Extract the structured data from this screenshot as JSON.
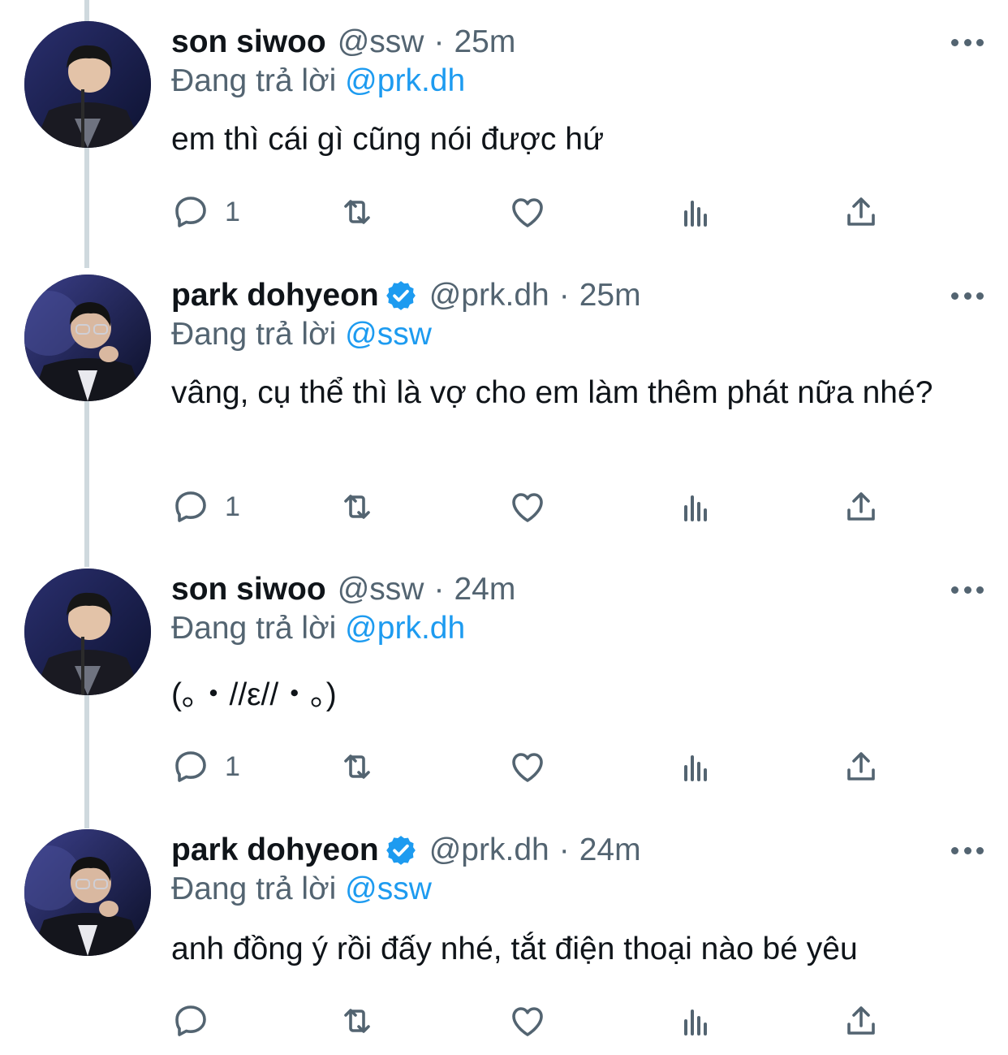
{
  "colors": {
    "accent": "#1d9bf0",
    "secondary_text": "#536471",
    "thread_line": "#cfd9de"
  },
  "tweets": [
    {
      "name": "son siwoo",
      "verified": false,
      "handle": "@ssw",
      "separator": "·",
      "time": "25m",
      "replying_prefix": "Đang trả lời",
      "replying_to": "@prk.dh",
      "text": "em thì cái gì cũng nói được hứ",
      "reply_count": "1",
      "icons": [
        "reply-icon",
        "retweet-icon",
        "like-icon",
        "analytics-icon",
        "share-icon"
      ]
    },
    {
      "name": "park dohyeon",
      "verified": true,
      "handle": "@prk.dh",
      "separator": "·",
      "time": "25m",
      "replying_prefix": "Đang trả lời",
      "replying_to": "@ssw",
      "text": "vâng, cụ thể thì là vợ cho em làm thêm phát nữa nhé?",
      "reply_count": "1",
      "icons": [
        "reply-icon",
        "retweet-icon",
        "like-icon",
        "analytics-icon",
        "share-icon"
      ]
    },
    {
      "name": "son siwoo",
      "verified": false,
      "handle": "@ssw",
      "separator": "·",
      "time": "24m",
      "replying_prefix": "Đang trả lời",
      "replying_to": "@prk.dh",
      "text": "(｡・//ε//・｡)",
      "reply_count": "1",
      "icons": [
        "reply-icon",
        "retweet-icon",
        "like-icon",
        "analytics-icon",
        "share-icon"
      ]
    },
    {
      "name": "park dohyeon",
      "verified": true,
      "handle": "@prk.dh",
      "separator": "·",
      "time": "24m",
      "replying_prefix": "Đang trả lời",
      "replying_to": "@ssw",
      "text": "anh đồng ý rồi đấy nhé, tắt điện thoại nào bé yêu",
      "reply_count": "",
      "icons": [
        "reply-icon",
        "retweet-icon",
        "like-icon",
        "analytics-icon",
        "share-icon"
      ]
    }
  ]
}
